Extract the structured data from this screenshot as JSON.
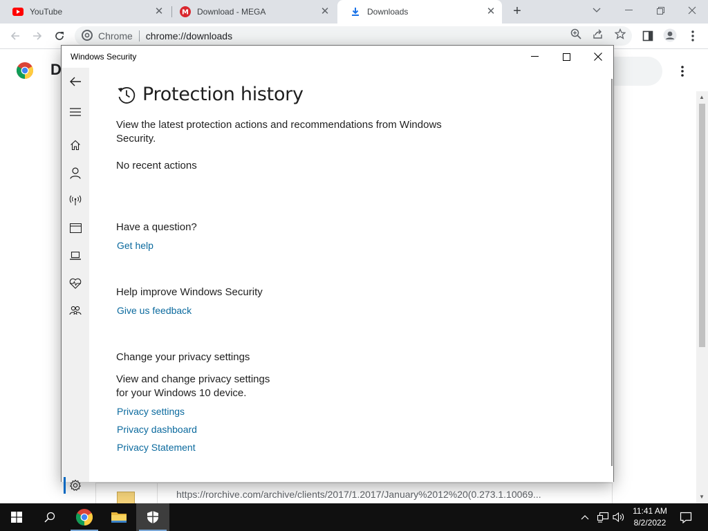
{
  "chrome": {
    "tabs": [
      {
        "label": "YouTube",
        "icon": "youtube-icon"
      },
      {
        "label": "Download - MEGA",
        "icon": "mega-icon"
      },
      {
        "label": "Downloads",
        "icon": "download-icon",
        "active": true
      }
    ],
    "omnibox": {
      "chip_label": "Chrome",
      "url": "chrome://downloads"
    }
  },
  "downloads_page": {
    "title_partial": "D",
    "entry_url": "https://rorchive.com/archive/clients/2017/1.2017/January%2012%20(0.273.1.10069..."
  },
  "security_window": {
    "title": "Windows Security",
    "heading": "Protection history",
    "description": "View the latest protection actions and recommendations from Windows Security.",
    "status": "No recent actions",
    "question": {
      "heading": "Have a question?",
      "link": "Get help"
    },
    "improve": {
      "heading": "Help improve Windows Security",
      "link": "Give us feedback"
    },
    "privacy": {
      "heading": "Change your privacy settings",
      "body": "View and change privacy settings for your Windows 10 device.",
      "links": [
        "Privacy settings",
        "Privacy dashboard",
        "Privacy Statement"
      ]
    }
  },
  "taskbar": {
    "time": "11:41 AM",
    "date": "8/2/2022"
  },
  "colors": {
    "link": "#0b6a9e",
    "accent": "#0067c0",
    "youtube_red": "#ff0000",
    "mega_red": "#d9272e",
    "download_blue": "#1a73e8",
    "taskbar": "#101010"
  }
}
